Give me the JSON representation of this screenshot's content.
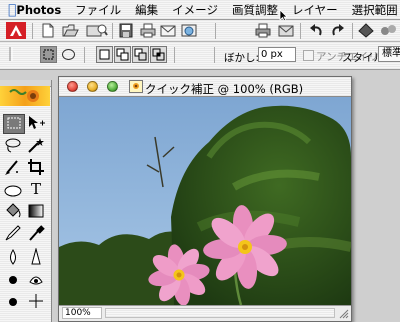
{
  "menubar": {
    "app": "Photos",
    "items": [
      "ファイル",
      "編集",
      "イメージ",
      "画質調整",
      "レイヤー",
      "選択範囲"
    ]
  },
  "options_bar": {
    "feather_label": "ぼかし:",
    "feather_value": "0 px",
    "antialias_label": "アンチエイリアス",
    "antialias_checked": false,
    "style_label": "スタイル:",
    "style_value": "標準"
  },
  "document": {
    "title": "クイック補正 @ 100% (RGB)",
    "zoom": "100%"
  },
  "colors": {
    "close": "#e54b3f",
    "minimize": "#e9b22b",
    "zoom": "#58b342",
    "sky": "#8db3d9",
    "petal": "#e98fbf"
  },
  "icons": {
    "menubar": [
      "apple-icon",
      "pointer-cursor-icon"
    ],
    "toolbar": [
      "adobe-logo-icon",
      "new-document-icon",
      "open-folder-icon",
      "browse-icon",
      "save-icon",
      "print-icon",
      "email-icon",
      "web-icon",
      "undo-icon",
      "redo-icon"
    ],
    "tools": [
      "marquee-tool-icon",
      "move-tool-icon",
      "lasso-tool-icon",
      "magic-wand-icon",
      "brush-tool-icon",
      "crop-tool-icon",
      "shape-tool-icon",
      "type-tool-icon",
      "paint-bucket-icon",
      "gradient-tool-icon",
      "pencil-tool-icon",
      "eyedropper-icon",
      "blur-tool-icon",
      "sharpen-tool-icon",
      "sponge-tool-icon",
      "burn-tool-icon"
    ]
  }
}
